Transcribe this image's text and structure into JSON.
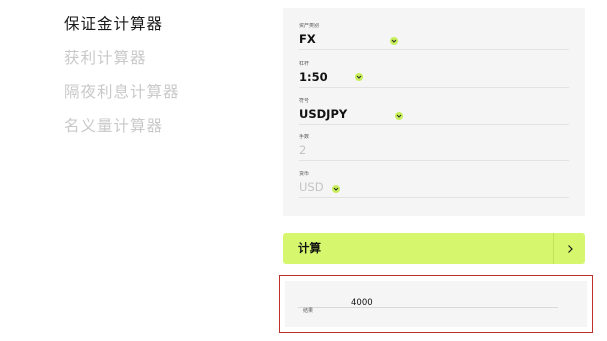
{
  "nav": {
    "items": [
      {
        "label": "保证金计算器",
        "active": true
      },
      {
        "label": "获利计算器",
        "active": false
      },
      {
        "label": "隔夜利息计算器",
        "active": false
      },
      {
        "label": "名义量计算器",
        "active": false
      }
    ]
  },
  "form": {
    "asset_class": {
      "label": "资产类别",
      "value": "FX"
    },
    "leverage": {
      "label": "杠杆",
      "value": "1:50"
    },
    "symbol": {
      "label": "符号",
      "value": "USDJPY"
    },
    "lots": {
      "label": "手数",
      "value": "2"
    },
    "currency": {
      "label": "货币",
      "value": "USD"
    }
  },
  "calculate": {
    "label": "计算"
  },
  "result": {
    "label": "结果",
    "value": "4000"
  },
  "icons": {
    "dropdown": "chevron-down-icon",
    "calculate_arrow": "chevron-right-icon"
  },
  "colors": {
    "accent": "#d6f76d",
    "chevron_bg": "#c6ef5a",
    "highlight_border": "#c0302b",
    "panel_bg": "#f5f5f5",
    "inactive_text": "#c9c9c9"
  }
}
